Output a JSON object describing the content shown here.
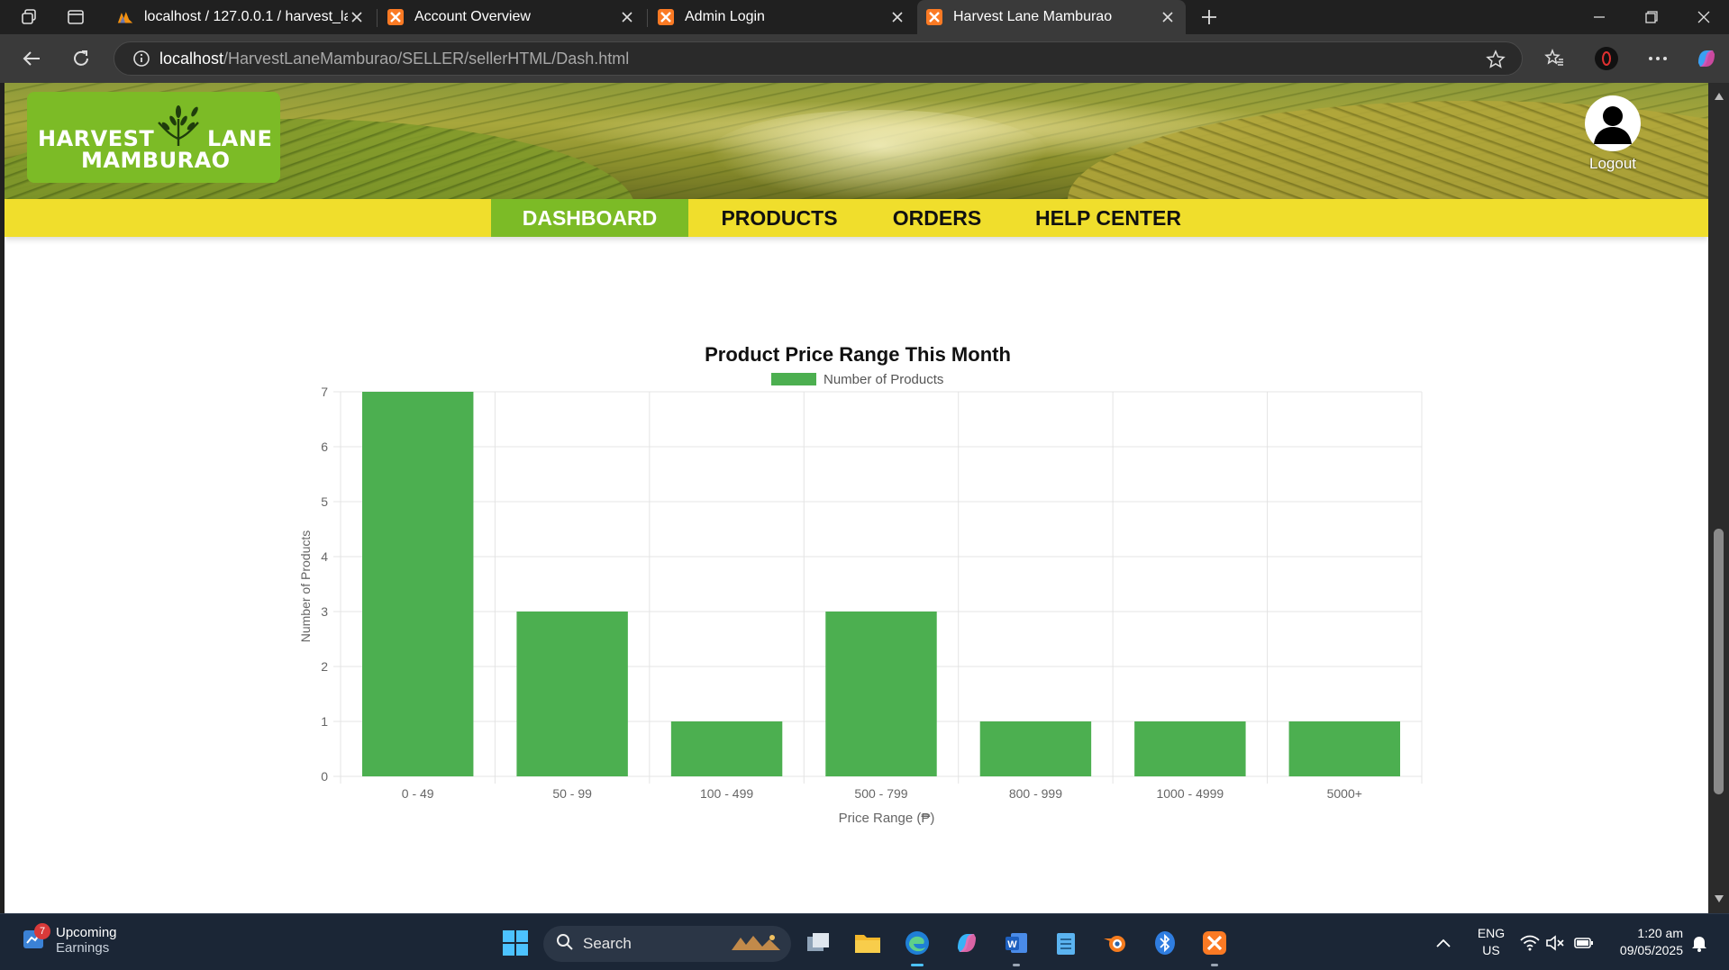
{
  "browser": {
    "tabs": [
      {
        "title": "localhost / 127.0.0.1 / harvest_lan",
        "favicon": "phpmyadmin-icon"
      },
      {
        "title": "Account Overview",
        "favicon": "xampp-icon"
      },
      {
        "title": "Admin Login",
        "favicon": "xampp-icon"
      },
      {
        "title": "Harvest Lane Mamburao",
        "favicon": "xampp-icon",
        "active": true
      }
    ],
    "address": {
      "host": "localhost",
      "path": "/HarvestLaneMamburao/SELLER/sellerHTML/Dash.html"
    }
  },
  "site": {
    "logo": {
      "line1_left": "HARVEST",
      "line1_right": "LANE",
      "line2": "MAMBURAO"
    },
    "user": {
      "logout_label": "Logout"
    },
    "nav": [
      {
        "label": "DASHBOARD",
        "active": true
      },
      {
        "label": "PRODUCTS"
      },
      {
        "label": "ORDERS"
      },
      {
        "label": "HELP CENTER"
      }
    ]
  },
  "chart_data": {
    "type": "bar",
    "title": "Product Price Range This Month",
    "categories": [
      "0 - 49",
      "50 - 99",
      "100 - 499",
      "500 - 799",
      "800 - 999",
      "1000 - 4999",
      "5000+"
    ],
    "series": [
      {
        "name": "Number of Products",
        "values": [
          7,
          3,
          1,
          3,
          1,
          1,
          1
        ],
        "color": "#4caf50"
      }
    ],
    "xlabel": "Price Range (₱)",
    "ylabel": "Number of Products",
    "ylim": [
      0,
      7
    ],
    "yticks": [
      0,
      1,
      2,
      3,
      4,
      5,
      6,
      7
    ],
    "grid": true,
    "legend_position": "top"
  },
  "taskbar": {
    "weather": {
      "badge": "7",
      "line1": "Upcoming",
      "line2": "Earnings"
    },
    "search_label": "Search",
    "lang": {
      "line1": "ENG",
      "line2": "US"
    },
    "clock": {
      "time": "1:20 am",
      "date": "09/05/2025"
    }
  }
}
